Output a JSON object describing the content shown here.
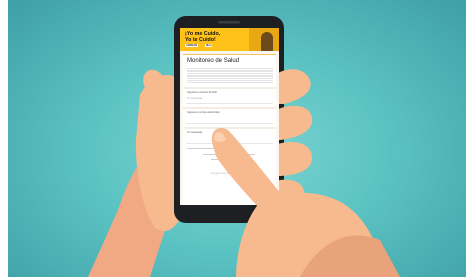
{
  "screen": {
    "banner": {
      "title_line1": "¡Yo me Cuido,",
      "title_line2": "Yo te Cuido!",
      "logo_left": "ANDEAN",
      "logo_right": "fibra"
    },
    "form": {
      "title": "Monitoreo de Salud",
      "field1_label": "Ingresa tu número de DNI",
      "field1_hint": "Tu respuesta",
      "field2_label": "Ingresa tu correo electrónico",
      "field3_label": "Tu respuesta",
      "footer": "Google Formularios"
    }
  },
  "colors": {
    "background": "#5cc3c3",
    "banner": "#ffc21a",
    "skin": "#f7b98e",
    "sleeve": "#e8a37a",
    "phone": "#1d1f22"
  }
}
